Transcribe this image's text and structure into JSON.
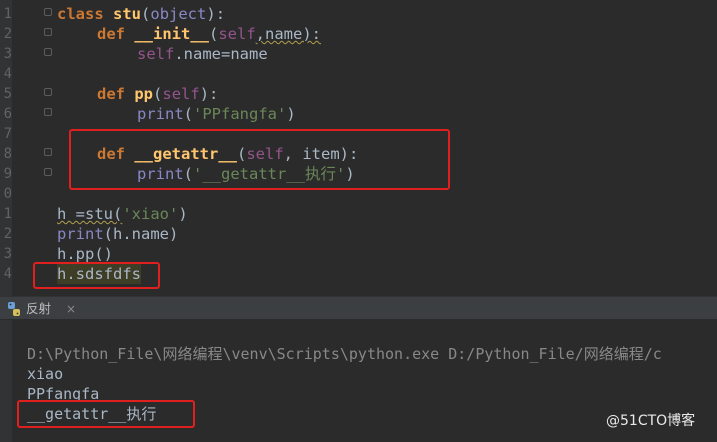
{
  "editor": {
    "line_numbers": [
      "1",
      "2",
      "3",
      "4",
      "5",
      "6",
      "7",
      "8",
      "9",
      "0",
      "1",
      "2",
      "3",
      "4"
    ],
    "l1": {
      "kw": "class",
      "name": "stu",
      "p1": "(",
      "base": "object",
      "p2": "):"
    },
    "l2": {
      "kw": "def",
      "name": "__init__",
      "p1": "(",
      "self": "self",
      "p2": ",name):"
    },
    "l3": {
      "self": "self",
      "rest": ".name=name"
    },
    "l5": {
      "kw": "def",
      "name": "pp",
      "p1": "(",
      "self": "self",
      "p2": "):"
    },
    "l6": {
      "fn": "print",
      "p1": "(",
      "str": "'PPfangfa'",
      "p2": ")"
    },
    "l8": {
      "kw": "def",
      "name": "__getattr__",
      "p1": "(",
      "self": "self",
      "p2": ", item):"
    },
    "l9": {
      "fn": "print",
      "p1": "(",
      "str": "'__getattr__执行'",
      "p2": ")"
    },
    "l11": {
      "a": "h =stu(",
      "str": "'xiao'",
      "b": ")"
    },
    "l12": {
      "fn": "print",
      "rest": "(h.name)"
    },
    "l13": {
      "text": "h.pp()"
    },
    "l14": {
      "text": "h.sdsfdfs"
    }
  },
  "run_panel": {
    "title": "反射",
    "close": "×"
  },
  "console": {
    "cmd": "D:\\Python_File\\网络编程\\venv\\Scripts\\python.exe D:/Python_File/网络编程/c",
    "out1": "xiao",
    "out2": "PPfangfa",
    "out3": "__getattr__执行"
  },
  "watermark": {
    "text": "@51CTO博客"
  },
  "colors": {
    "keyword": "#cc7832",
    "function": "#ffc66d",
    "string": "#6a8759",
    "self": "#94558d",
    "highlight": "#e0201e"
  }
}
